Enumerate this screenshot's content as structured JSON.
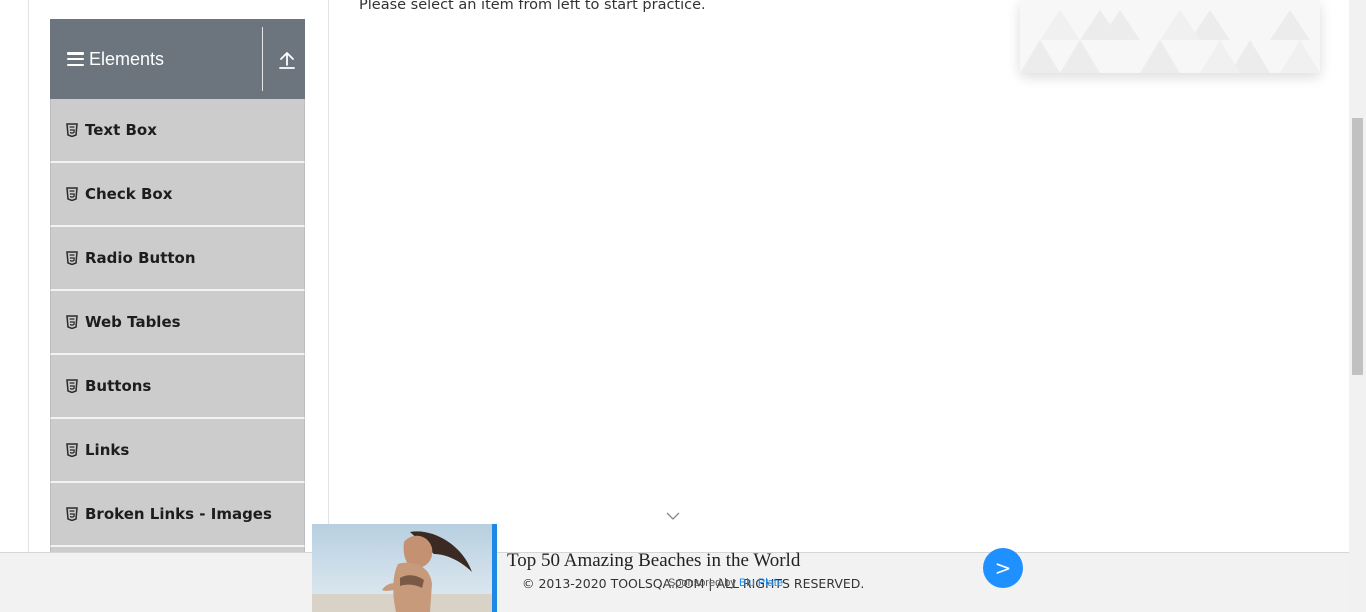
{
  "sidebar": {
    "group": {
      "title": "Elements",
      "menu_icon": "hamburger-icon",
      "collapse_icon": "upload-arrow-icon"
    },
    "items": [
      {
        "label": "Text Box",
        "icon": "html5-icon"
      },
      {
        "label": "Check Box",
        "icon": "html5-icon"
      },
      {
        "label": "Radio Button",
        "icon": "html5-icon"
      },
      {
        "label": "Web Tables",
        "icon": "html5-icon"
      },
      {
        "label": "Buttons",
        "icon": "html5-icon"
      },
      {
        "label": "Links",
        "icon": "html5-icon"
      },
      {
        "label": "Broken Links - Images",
        "icon": "html5-icon"
      }
    ]
  },
  "main": {
    "intro_text": "Please select an item from left to start practice."
  },
  "footer": {
    "copyright": "© 2013-2020 TOOLSQA.COM | ALL RIGHTS RESERVED."
  },
  "ad": {
    "title": "Top 50 Amazing Beaches in the World",
    "sponsored_prefix": "Sponsored by ",
    "sponsor_name": "Blu Plate",
    "next_label": ">"
  },
  "colors": {
    "group_header": "#6c757d",
    "menu_item": "#cccccc",
    "ad_accent": "#1e88e5",
    "ad_button": "#1e90ff"
  }
}
